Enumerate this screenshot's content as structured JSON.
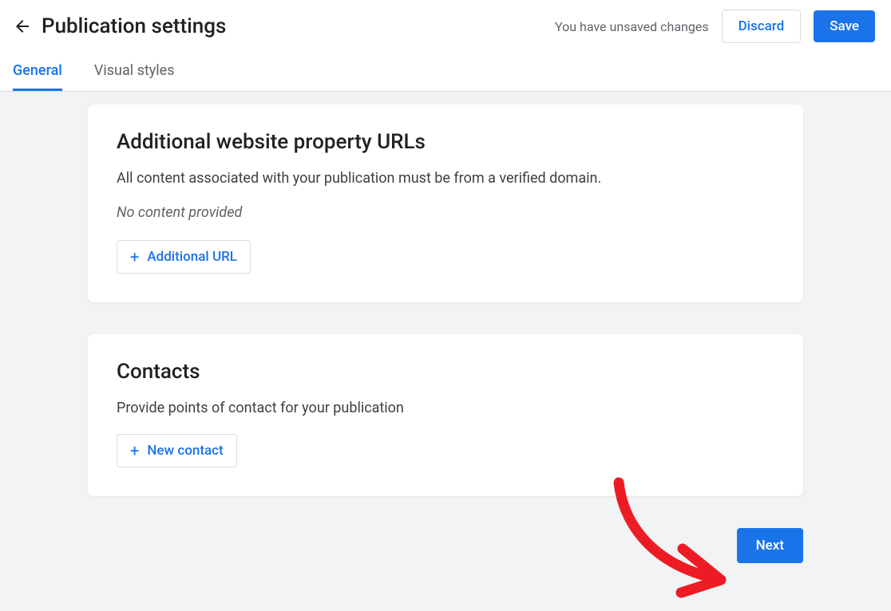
{
  "header": {
    "title": "Publication settings",
    "unsaved_message": "You have unsaved changes",
    "discard_label": "Discard",
    "save_label": "Save"
  },
  "tabs": {
    "general": "General",
    "visual_styles": "Visual styles"
  },
  "cards": {
    "urls": {
      "title": "Additional website property URLs",
      "description": "All content associated with your publication must be from a verified domain.",
      "empty": "No content provided",
      "add_label": "Additional URL"
    },
    "contacts": {
      "title": "Contacts",
      "description": "Provide points of contact for your publication",
      "add_label": "New contact"
    }
  },
  "footer": {
    "next_label": "Next"
  }
}
